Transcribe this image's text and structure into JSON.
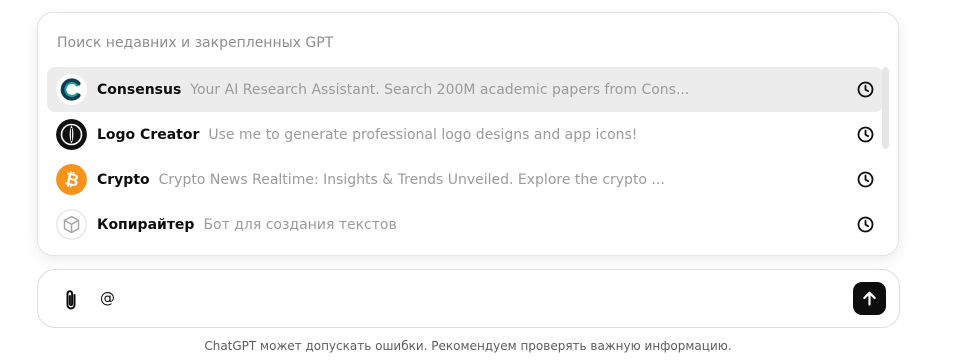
{
  "popup": {
    "header": "Поиск недавних и закрепленных GPT",
    "items": [
      {
        "name": "Consensus",
        "description": "Your AI Research Assistant. Search 200M academic papers from Cons...",
        "icon": "consensus-logo-icon",
        "trailing_icon": "clock-icon",
        "active": true
      },
      {
        "name": "Logo Creator",
        "description": "Use me to generate professional logo designs and app icons!",
        "icon": "logo-creator-icon",
        "trailing_icon": "clock-icon",
        "active": false
      },
      {
        "name": "Crypto",
        "description": "Crypto News Realtime: Insights & Trends Unveiled. Explore the crypto ...",
        "icon": "bitcoin-icon",
        "trailing_icon": "clock-icon",
        "active": false
      },
      {
        "name": "Копирайтер",
        "description": "Бот для создания текстов",
        "icon": "cube-icon",
        "trailing_icon": "clock-icon",
        "active": false
      }
    ]
  },
  "composer": {
    "value": "@",
    "attach_icon": "paperclip-icon",
    "send_icon": "arrow-up-icon"
  },
  "footer": {
    "disclaimer": "ChatGPT может допускать ошибки. Рекомендуем проверять важную информацию."
  },
  "colors": {
    "active_row": "#ececec",
    "send_button": "#0d0d0d",
    "bitcoin": "#f7931a",
    "consensus_teal": "#1aa39a"
  }
}
